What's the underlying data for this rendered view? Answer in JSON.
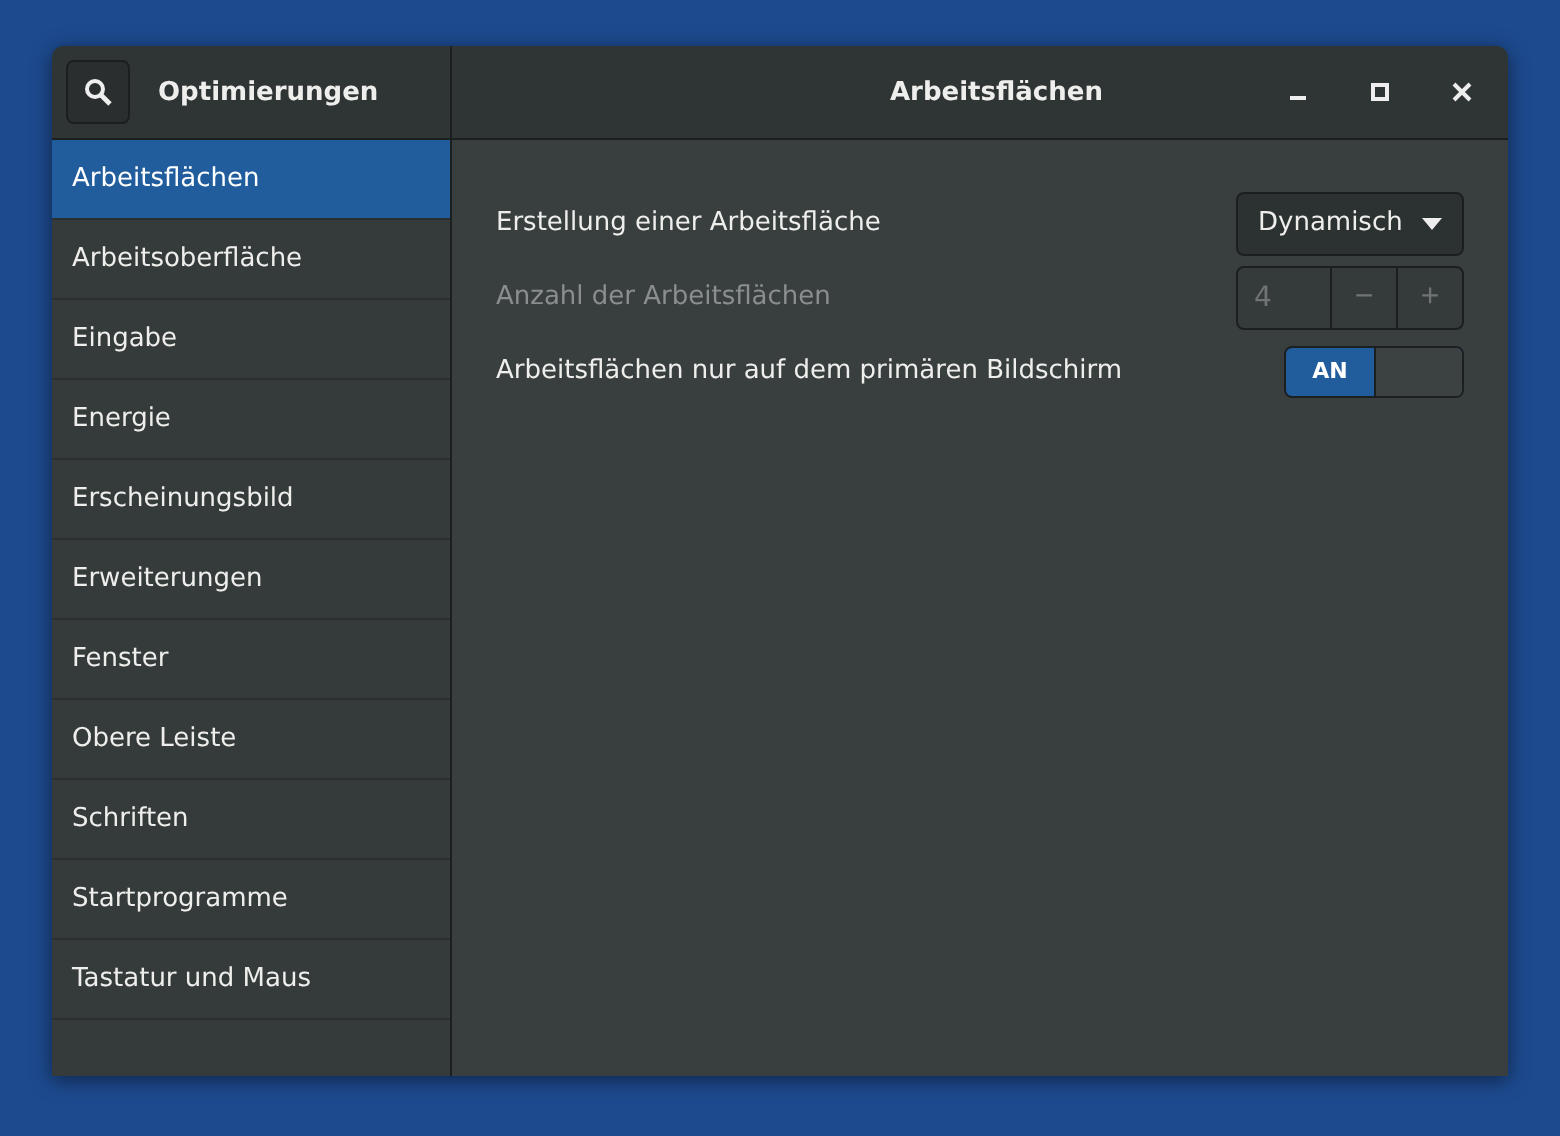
{
  "app_title": "Optimierungen",
  "window": {
    "title": "Arbeitsflächen"
  },
  "sidebar": {
    "items": [
      {
        "label": "Arbeitsflächen",
        "selected": true
      },
      {
        "label": "Arbeitsoberfläche",
        "selected": false
      },
      {
        "label": "Eingabe",
        "selected": false
      },
      {
        "label": "Energie",
        "selected": false
      },
      {
        "label": "Erscheinungsbild",
        "selected": false
      },
      {
        "label": "Erweiterungen",
        "selected": false
      },
      {
        "label": "Fenster",
        "selected": false
      },
      {
        "label": "Obere Leiste",
        "selected": false
      },
      {
        "label": "Schriften",
        "selected": false
      },
      {
        "label": "Startprogramme",
        "selected": false
      },
      {
        "label": "Tastatur und Maus",
        "selected": false
      }
    ]
  },
  "settings": [
    {
      "kind": "dropdown",
      "label": "Erstellung einer Arbeitsfläche",
      "disabled": false,
      "value": "Dynamisch"
    },
    {
      "kind": "spin",
      "label": "Anzahl der Arbeitsflächen",
      "disabled": true,
      "value": "4",
      "minus": "−",
      "plus": "+"
    },
    {
      "kind": "switch",
      "label": "Arbeitsflächen nur auf dem primären Bildschirm",
      "disabled": false,
      "on": true,
      "on_label": "AN"
    }
  ]
}
